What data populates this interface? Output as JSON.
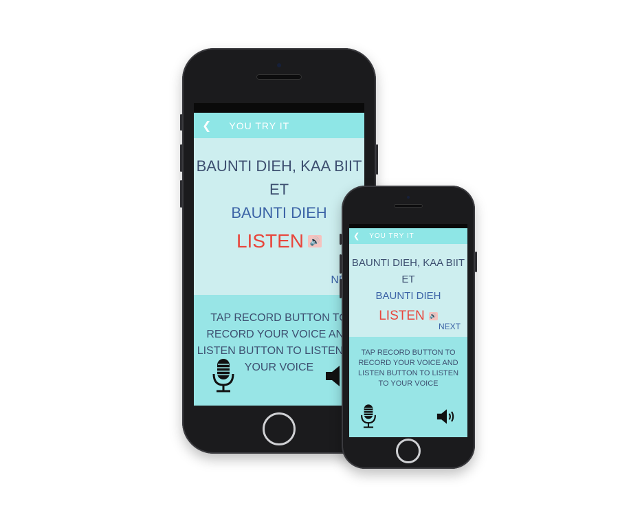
{
  "header": {
    "title": "You try it",
    "back_icon": "chevron-left-icon"
  },
  "phrase": {
    "line1": "Baunti dieh, kaa biit et",
    "line2": "Baunti dieh"
  },
  "listen": {
    "label": "Listen",
    "icon": "speaker-small-icon"
  },
  "next": {
    "label": "Next"
  },
  "instructions": "Tap record button to record your voice and listen button to listen to your voice",
  "controls": {
    "record_icon": "microphone-icon",
    "play_icon": "speaker-volume-icon"
  },
  "colors": {
    "header": "#8ee6e6",
    "upper_panel": "#cdeeef",
    "lower_panel": "#98e5e6",
    "listen_accent": "#e8463c",
    "text_dark": "#3d4f70",
    "text_blue": "#3b63a6",
    "phone_body": "#1b1b1d"
  }
}
